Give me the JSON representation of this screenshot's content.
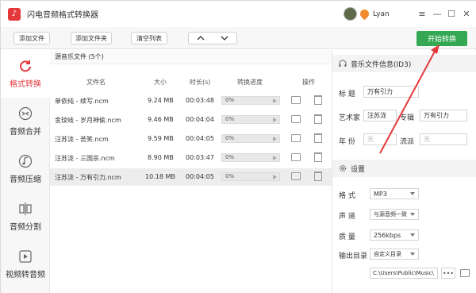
{
  "app": {
    "title": "闪电音频格式转换器",
    "user": "Lyan",
    "brand_color": "#e4393c"
  },
  "toolbar": {
    "add_file": "添加文件",
    "add_folder": "添加文件夹",
    "clear_list": "清空列表",
    "move_up": "▲",
    "move_down": "▼",
    "start": "开始转换"
  },
  "sidebar": {
    "items": [
      {
        "label": "格式转换",
        "active": true
      },
      {
        "label": "音频合并"
      },
      {
        "label": "音频压缩"
      },
      {
        "label": "音频分割"
      },
      {
        "label": "视频转音频"
      }
    ]
  },
  "list": {
    "header": "源音乐文件 (5个)",
    "columns": [
      "文件名",
      "大小",
      "时长(s)",
      "转换进度",
      "操作"
    ],
    "rows": [
      {
        "name": "单依纯 - 续写.ncm",
        "size": "9.24 MB",
        "duration": "00:03:48",
        "progress": "0%"
      },
      {
        "name": "金玟岐 - 岁月神偷.ncm",
        "size": "9.46 MB",
        "duration": "00:04:04",
        "progress": "0%"
      },
      {
        "name": "汪苏泷 - 苦笑.ncm",
        "size": "9.59 MB",
        "duration": "00:04:05",
        "progress": "0%"
      },
      {
        "name": "汪苏泷 - 三国杀.ncm",
        "size": "8.90 MB",
        "duration": "00:03:47",
        "progress": "0%"
      },
      {
        "name": "汪苏泷 - 万有引力.ncm",
        "size": "10.18 MB",
        "duration": "00:04:05",
        "progress": "0%"
      }
    ]
  },
  "info": {
    "section_title": "音乐文件信息(ID3)",
    "title_label": "标 题",
    "title_value": "万有引力",
    "artist_label": "艺术家",
    "artist_value": "汪苏泷",
    "album_label": "专辑",
    "album_value": "万有引力",
    "year_label": "年 份",
    "year_value": "无",
    "genre_label": "流派",
    "genre_value": "无"
  },
  "settings": {
    "section_title": "设置",
    "format_label": "格 式",
    "format_value": "MP3",
    "channel_label": "声 道",
    "channel_value": "与源音频一致",
    "quality_label": "质 量",
    "quality_value": "256kbps",
    "output_label": "输出目录",
    "output_value": "自定义目录",
    "path_value": "C:\\Users\\Public\\Music\\",
    "browse_label": "•••"
  }
}
